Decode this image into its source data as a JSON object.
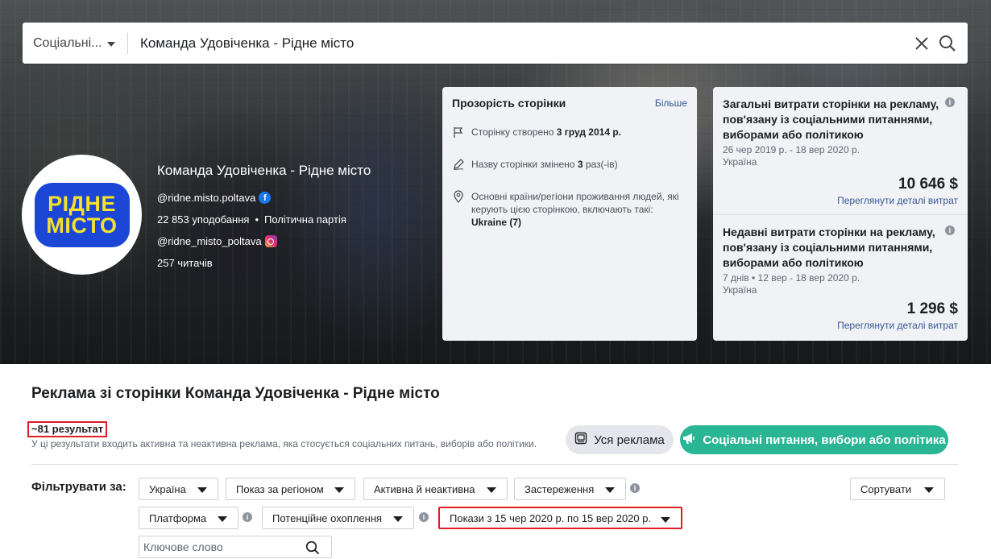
{
  "search": {
    "category": "Соціальні...",
    "query": "Команда Удовіченка - Рідне місто"
  },
  "page": {
    "name": "Команда Удовіченка - Рідне місто",
    "logo_lines": [
      "РІДНЕ",
      "МІСТО"
    ],
    "facebook_handle": "@ridne.misto.poltava",
    "likes": "22 853 уподобання",
    "category": "Політична партія",
    "instagram_handle": "@ridne_misto_poltava",
    "followers": "257 читачів"
  },
  "transparency": {
    "title": "Прозорість сторінки",
    "more_link": "Більше",
    "created_prefix": "Сторінку створено",
    "created_date": "3 груд 2014 р.",
    "renamed_prefix": "Назву сторінки змінено",
    "renamed_count": "3",
    "renamed_suffix": "раз(-ів)",
    "countries_text": "Основні країни/регіони проживання людей, які керують цією сторінкою, включають такі:",
    "countries_value": "Ukraine (7)"
  },
  "spend": {
    "total": {
      "title": "Загальні витрати сторінки на рекламу, пов'язану із соціальними питаннями, виборами або політикою",
      "period": "26 чер 2019 р. - 18 вер 2020 р.",
      "country": "Україна",
      "amount": "10 646 $",
      "link": "Переглянути деталі витрат"
    },
    "recent": {
      "title": "Недавні витрати сторінки на рекламу, пов'язану із соціальними питаннями, виборами або політикою",
      "period": "7 днів • 12 вер - 18 вер 2020 р.",
      "country": "Україна",
      "amount": "1 296 $",
      "link": "Переглянути деталі витрат"
    }
  },
  "ads": {
    "title": "Реклама зі сторінки Команда Удовіченка - Рідне місто",
    "results": "~81 результат",
    "results_note": "У ці результати входить активна та неактивна реклама, яка стосується соціальних питань, виборів або політики.",
    "btn_all": "Уся реклама",
    "btn_social": "Соціальні питання, вибори або політика"
  },
  "filters": {
    "label": "Фільтрувати за:",
    "country": "Україна",
    "region": "Показ за регіоном",
    "status": "Активна й неактивна",
    "disclaimer": "Застереження",
    "sort": "Сортувати",
    "platform": "Платформа",
    "reach": "Потенційне охоплення",
    "date_range": "Покази з 15 чер 2020 р. по 15 вер 2020 р.",
    "keyword_placeholder": "Ключове слово"
  },
  "colors": {
    "accent_green": "#2ab595",
    "link_blue": "#385898",
    "highlight_red": "#e01c24",
    "logo_blue": "#1c47d6",
    "logo_yellow": "#f6e12b"
  }
}
